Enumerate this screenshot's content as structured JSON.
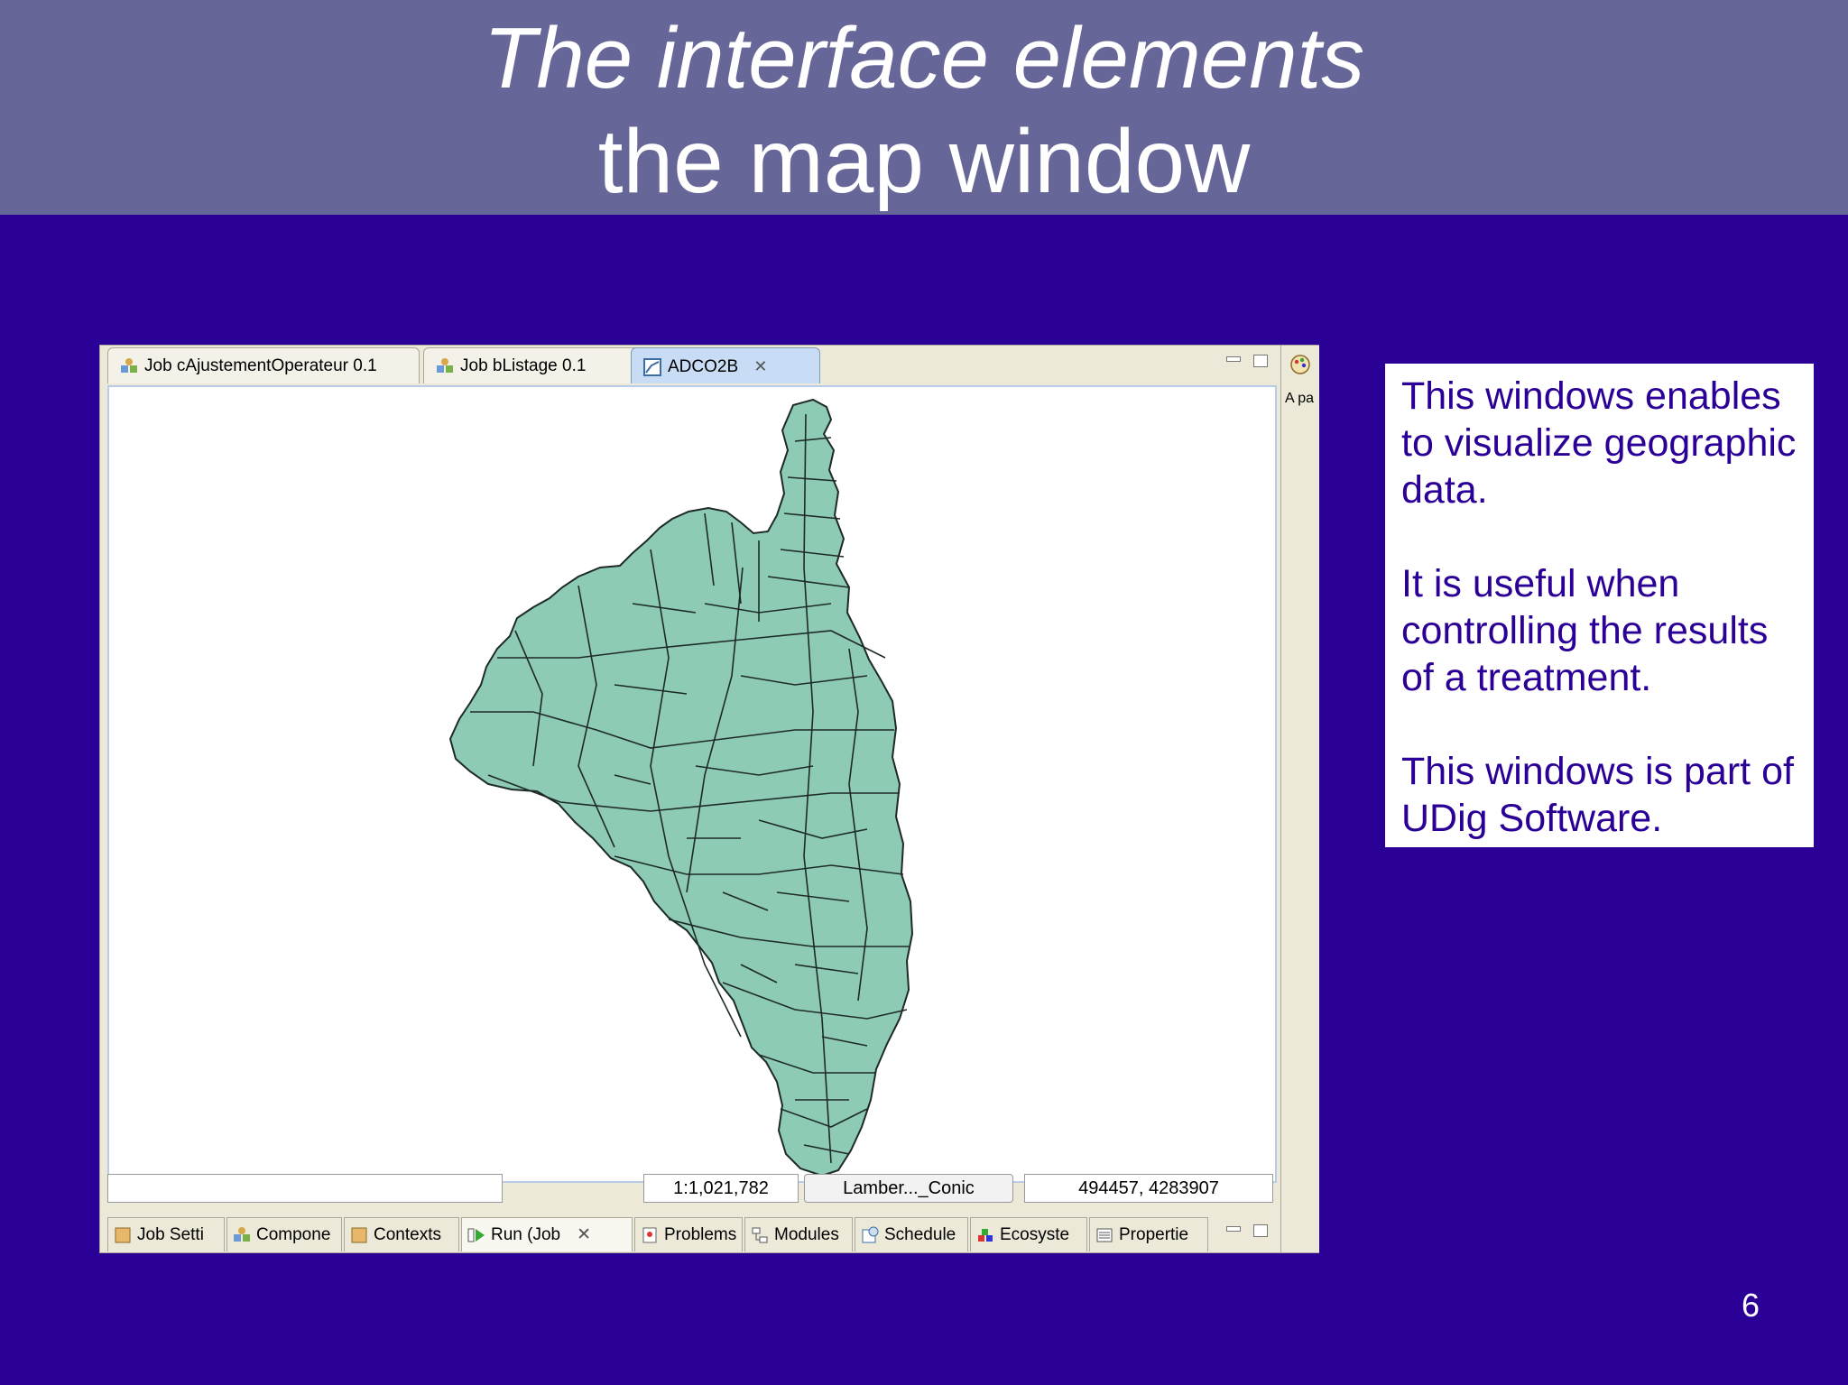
{
  "slide": {
    "title_line1": "The interface elements",
    "title_line2": "the map window",
    "page_number": "6"
  },
  "editor_tabs": [
    {
      "label": "Job cAjustementOperateur 0.1",
      "icon": "job-icon"
    },
    {
      "label": "Job bListage 0.1",
      "icon": "job-icon"
    },
    {
      "label": "ADCO2B",
      "icon": "map-icon",
      "active": true
    }
  ],
  "side_panel": {
    "label": "A pa",
    "icon": "palette-icon"
  },
  "map": {
    "fill_color": "#8ecbb4",
    "stroke_color": "#1e2a28"
  },
  "status": {
    "scale": "1:1,021,782",
    "crs": "Lamber..._Conic",
    "coordinates": "494457, 4283907"
  },
  "bottom_tabs": [
    {
      "label": "Job Setti",
      "icon": "job-settings-icon"
    },
    {
      "label": "Compone",
      "icon": "component-icon"
    },
    {
      "label": "Contexts",
      "icon": "contexts-icon"
    },
    {
      "label": "Run (Job",
      "icon": "run-icon",
      "active": true
    },
    {
      "label": "Problems",
      "icon": "problems-icon"
    },
    {
      "label": "Modules",
      "icon": "modules-icon"
    },
    {
      "label": "Schedule",
      "icon": "schedule-icon"
    },
    {
      "label": "Ecosyste",
      "icon": "ecosystem-icon"
    },
    {
      "label": "Propertie",
      "icon": "properties-icon"
    }
  ],
  "description": {
    "p1": "This windows enables to visualize geographic data.",
    "p2": "It is useful when controlling the results of a treatment.",
    "p3": "This windows is part of UDig Software."
  }
}
